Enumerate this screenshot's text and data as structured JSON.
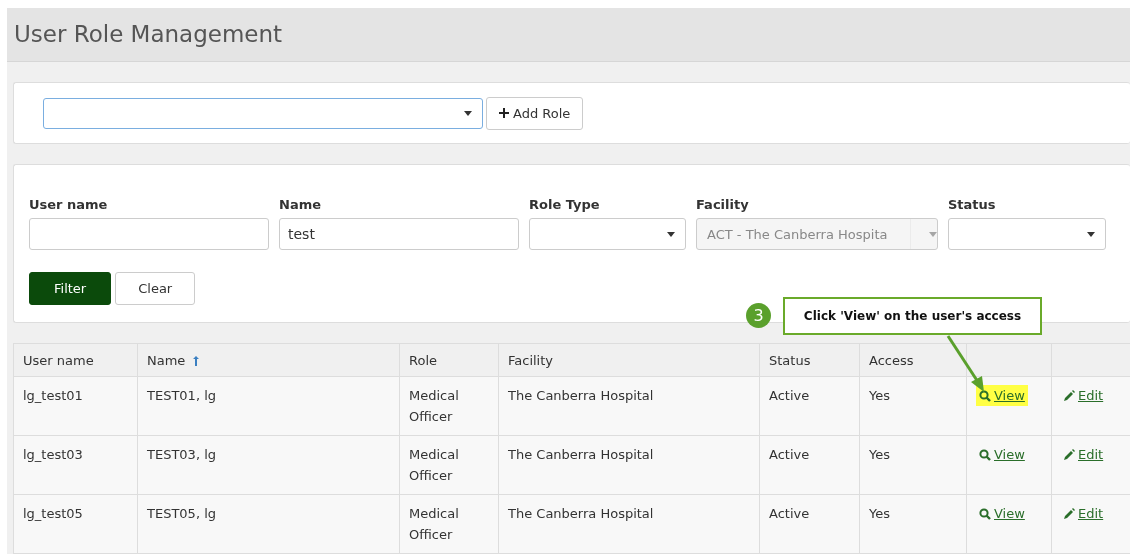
{
  "page_title": "User Role Management",
  "role_bar": {
    "add_button": "Add Role"
  },
  "filters": [
    {
      "label": "User name",
      "kind": "text",
      "disabled": false
    },
    {
      "label": "Name",
      "kind": "text",
      "value": "test",
      "disabled": false
    },
    {
      "label": "Role Type",
      "kind": "select",
      "disabled": false
    },
    {
      "label": "Facility",
      "kind": "select",
      "value": "ACT - The Canberra Hospita",
      "disabled": true
    },
    {
      "label": "Status",
      "kind": "select",
      "disabled": false
    }
  ],
  "filter_buttons": {
    "filter": "Filter",
    "clear": "Clear"
  },
  "callout": {
    "step": "3",
    "text": "Click 'View' on the user's access"
  },
  "table": {
    "columns": [
      {
        "label": "User name",
        "sorted": false
      },
      {
        "label": "Name",
        "sorted": true
      },
      {
        "label": "Role",
        "sorted": false
      },
      {
        "label": "Facility",
        "sorted": false
      },
      {
        "label": "Status",
        "sorted": false
      },
      {
        "label": "Access",
        "sorted": false
      }
    ],
    "rows": [
      {
        "cells": [
          "lg_test01",
          "TEST01, lg",
          "Medical Officer",
          "The Canberra Hospital",
          "Active",
          "Yes"
        ],
        "view": "View",
        "edit": "Edit",
        "highlighted": true
      },
      {
        "cells": [
          "lg_test03",
          "TEST03, lg",
          "Medical Officer",
          "The Canberra Hospital",
          "Active",
          "Yes"
        ],
        "view": "View",
        "edit": "Edit",
        "highlighted": false
      },
      {
        "cells": [
          "lg_test05",
          "TEST05, lg",
          "Medical Officer",
          "The Canberra Hospital",
          "Active",
          "Yes"
        ],
        "view": "View",
        "edit": "Edit",
        "highlighted": false
      }
    ]
  }
}
